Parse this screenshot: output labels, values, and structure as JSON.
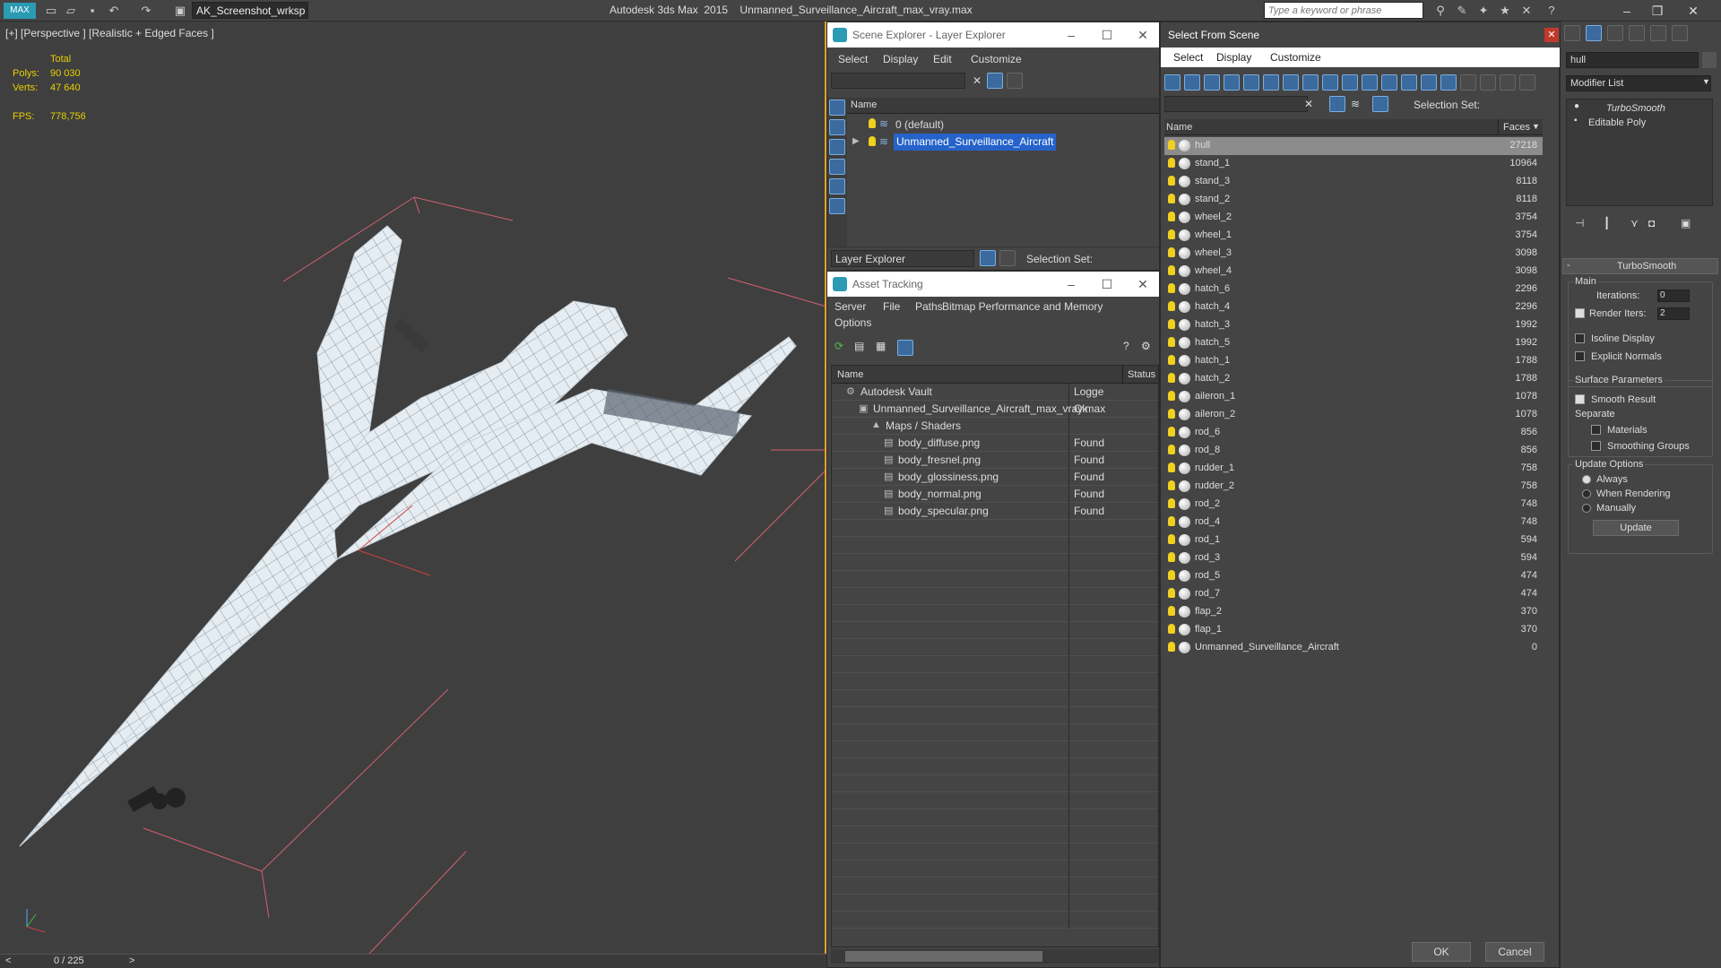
{
  "app": {
    "workspace": "AK_Screenshot_wrksp",
    "title": "Autodesk 3ds Max  2015    Unmanned_Surveillance_Aircraft_max_vray.max",
    "search_placeholder": "Type a keyword or phrase"
  },
  "viewport": {
    "label": "[+] [Perspective ] [Realistic + Edged Faces ]",
    "stats": {
      "total_label": "Total",
      "polys_label": "Polys:",
      "polys": "90 030",
      "verts_label": "Verts:",
      "verts": "47 640",
      "fps_label": "FPS:",
      "fps": "778,756"
    },
    "timeline": "0 / 225",
    "timeline_prev": "<",
    "timeline_next": ">"
  },
  "scene_explorer": {
    "title": "Scene Explorer - Layer Explorer",
    "menu": [
      "Select",
      "Display",
      "Edit",
      "Customize"
    ],
    "col_name": "Name",
    "layers": [
      {
        "name": "0 (default)",
        "selected": false
      },
      {
        "name": "Unmanned_Surveillance_Aircraft",
        "selected": true
      }
    ],
    "footer_mode": "Layer Explorer",
    "footer_selset": "Selection Set:"
  },
  "asset_tracking": {
    "title": "Asset Tracking",
    "menu": [
      "Server",
      "File",
      "Paths",
      "Bitmap Performance and Memory",
      "Options"
    ],
    "col_name": "Name",
    "col_status": "Status",
    "rows": [
      {
        "name": "Autodesk Vault",
        "status": "Logge",
        "indent": 0
      },
      {
        "name": "Unmanned_Surveillance_Aircraft_max_vray.max",
        "status": "Ok",
        "indent": 1
      },
      {
        "name": "Maps / Shaders",
        "status": "",
        "indent": 2
      },
      {
        "name": "body_diffuse.png",
        "status": "Found",
        "indent": 3
      },
      {
        "name": "body_fresnel.png",
        "status": "Found",
        "indent": 3
      },
      {
        "name": "body_glossiness.png",
        "status": "Found",
        "indent": 3
      },
      {
        "name": "body_normal.png",
        "status": "Found",
        "indent": 3
      },
      {
        "name": "body_specular.png",
        "status": "Found",
        "indent": 3
      }
    ]
  },
  "select_from_scene": {
    "title": "Select From Scene",
    "menu": [
      "Select",
      "Display",
      "Customize"
    ],
    "selset": "Selection Set:",
    "col_name": "Name",
    "col_faces": "Faces",
    "objects": [
      {
        "name": "hull",
        "faces": "27218"
      },
      {
        "name": "stand_1",
        "faces": "10964"
      },
      {
        "name": "stand_3",
        "faces": "8118"
      },
      {
        "name": "stand_2",
        "faces": "8118"
      },
      {
        "name": "wheel_2",
        "faces": "3754"
      },
      {
        "name": "wheel_1",
        "faces": "3754"
      },
      {
        "name": "wheel_3",
        "faces": "3098"
      },
      {
        "name": "wheel_4",
        "faces": "3098"
      },
      {
        "name": "hatch_6",
        "faces": "2296"
      },
      {
        "name": "hatch_4",
        "faces": "2296"
      },
      {
        "name": "hatch_3",
        "faces": "1992"
      },
      {
        "name": "hatch_5",
        "faces": "1992"
      },
      {
        "name": "hatch_1",
        "faces": "1788"
      },
      {
        "name": "hatch_2",
        "faces": "1788"
      },
      {
        "name": "aileron_1",
        "faces": "1078"
      },
      {
        "name": "aileron_2",
        "faces": "1078"
      },
      {
        "name": "rod_6",
        "faces": "856"
      },
      {
        "name": "rod_8",
        "faces": "856"
      },
      {
        "name": "rudder_1",
        "faces": "758"
      },
      {
        "name": "rudder_2",
        "faces": "758"
      },
      {
        "name": "rod_2",
        "faces": "748"
      },
      {
        "name": "rod_4",
        "faces": "748"
      },
      {
        "name": "rod_1",
        "faces": "594"
      },
      {
        "name": "rod_3",
        "faces": "594"
      },
      {
        "name": "rod_5",
        "faces": "474"
      },
      {
        "name": "rod_7",
        "faces": "474"
      },
      {
        "name": "flap_2",
        "faces": "370"
      },
      {
        "name": "flap_1",
        "faces": "370"
      },
      {
        "name": "Unmanned_Surveillance_Aircraft",
        "faces": "0"
      }
    ],
    "ok": "OK",
    "cancel": "Cancel"
  },
  "modify_panel": {
    "object_name": "hull",
    "modifier_list": "Modifier List",
    "stack": [
      "TurboSmooth",
      "Editable Poly"
    ],
    "rollout_title": "TurboSmooth",
    "main_label": "Main",
    "iterations_label": "Iterations:",
    "iterations": "0",
    "render_iters_label": "Render Iters:",
    "render_iters": "2",
    "isoline": "Isoline Display",
    "explicit_normals": "Explicit Normals",
    "surface_params": "Surface Parameters",
    "smooth_result": "Smooth Result",
    "separate": "Separate",
    "materials": "Materials",
    "smoothing_groups": "Smoothing Groups",
    "update_options": "Update Options",
    "always": "Always",
    "when_rendering": "When Rendering",
    "manually": "Manually",
    "update_btn": "Update"
  }
}
